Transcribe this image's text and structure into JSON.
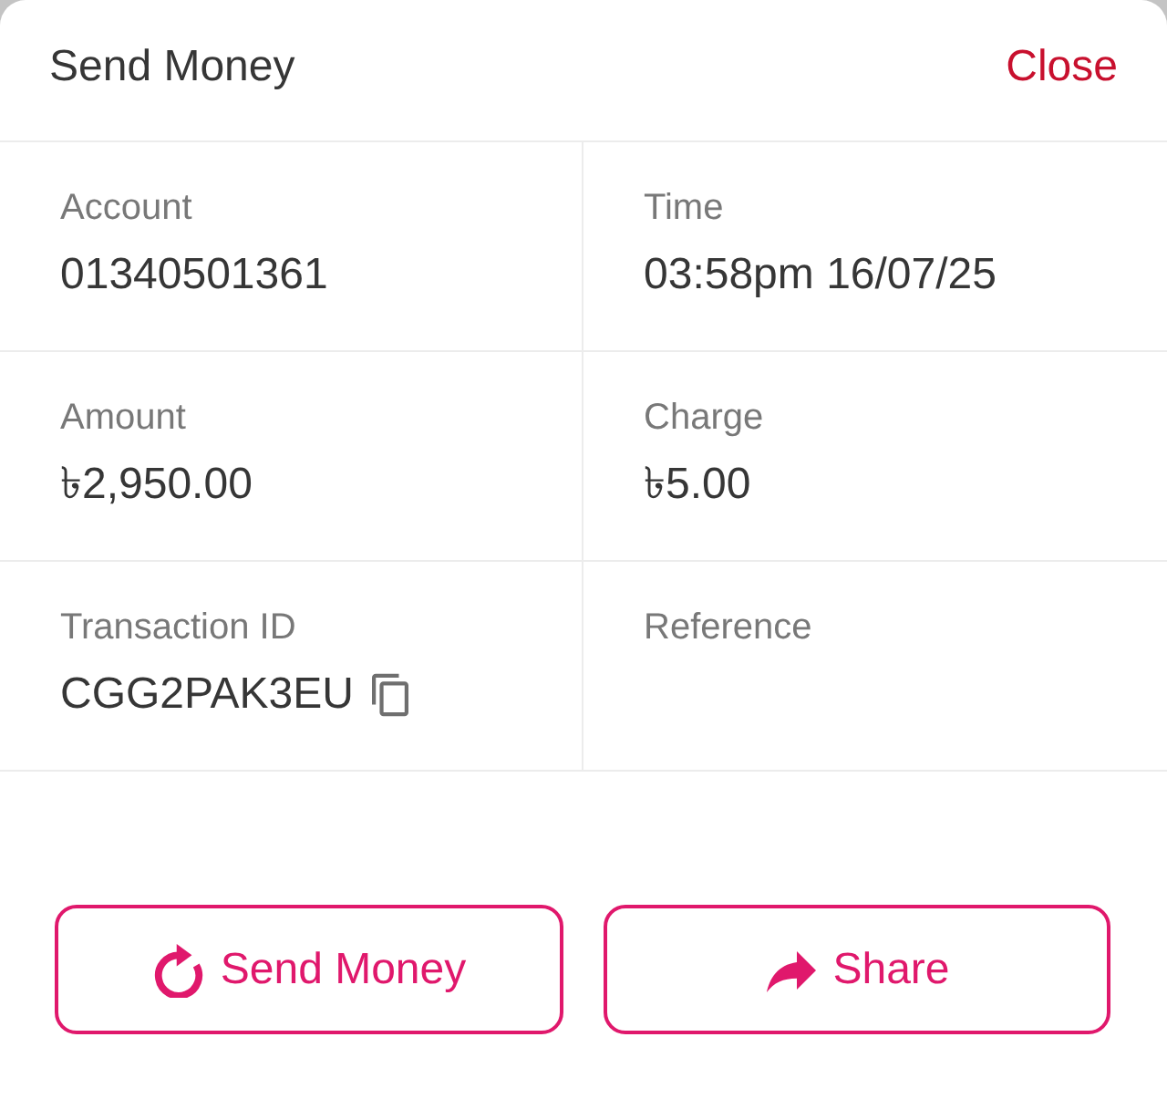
{
  "header": {
    "title": "Send Money",
    "close": "Close"
  },
  "fields": [
    {
      "label": "Account",
      "value": "01340501361",
      "copyable": false
    },
    {
      "label": "Time",
      "value": "03:58pm 16/07/25",
      "copyable": false
    },
    {
      "label": "Amount",
      "value": "৳2,950.00",
      "copyable": false
    },
    {
      "label": "Charge",
      "value": "৳5.00",
      "copyable": false
    },
    {
      "label": "Transaction ID",
      "value": "CGG2PAK3EU",
      "copyable": true
    },
    {
      "label": "Reference",
      "copyable": false
    }
  ],
  "buttons": [
    {
      "label": "Send Money",
      "kind": "refresh"
    },
    {
      "label": "Share",
      "kind": "share"
    }
  ]
}
